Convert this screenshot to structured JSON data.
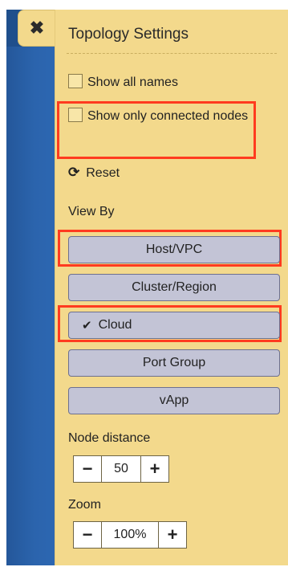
{
  "panel": {
    "title": "Topology Settings",
    "close_icon": "✖",
    "show_all_names": {
      "label": "Show all names",
      "checked": false
    },
    "show_only_connected": {
      "label": "Show only connected nodes",
      "checked": false
    },
    "reset": {
      "icon": "⟳",
      "label": "Reset"
    },
    "view_by": {
      "label": "View By",
      "options": [
        {
          "label": "Host/VPC",
          "selected": false
        },
        {
          "label": "Cluster/Region",
          "selected": false
        },
        {
          "label": "Cloud",
          "selected": true
        },
        {
          "label": "Port Group",
          "selected": false
        },
        {
          "label": "vApp",
          "selected": false
        }
      ],
      "selected_check_icon": "✔"
    },
    "node_distance": {
      "label": "Node distance",
      "minus": "−",
      "value": "50",
      "plus": "+"
    },
    "zoom": {
      "label": "Zoom",
      "minus": "−",
      "value": "100%",
      "plus": "+"
    }
  },
  "colors": {
    "panel_bg": "#f3d98c",
    "button_bg": "#c3c4d6",
    "highlight": "#ff3b1f",
    "backdrop": "#2b64ad"
  }
}
